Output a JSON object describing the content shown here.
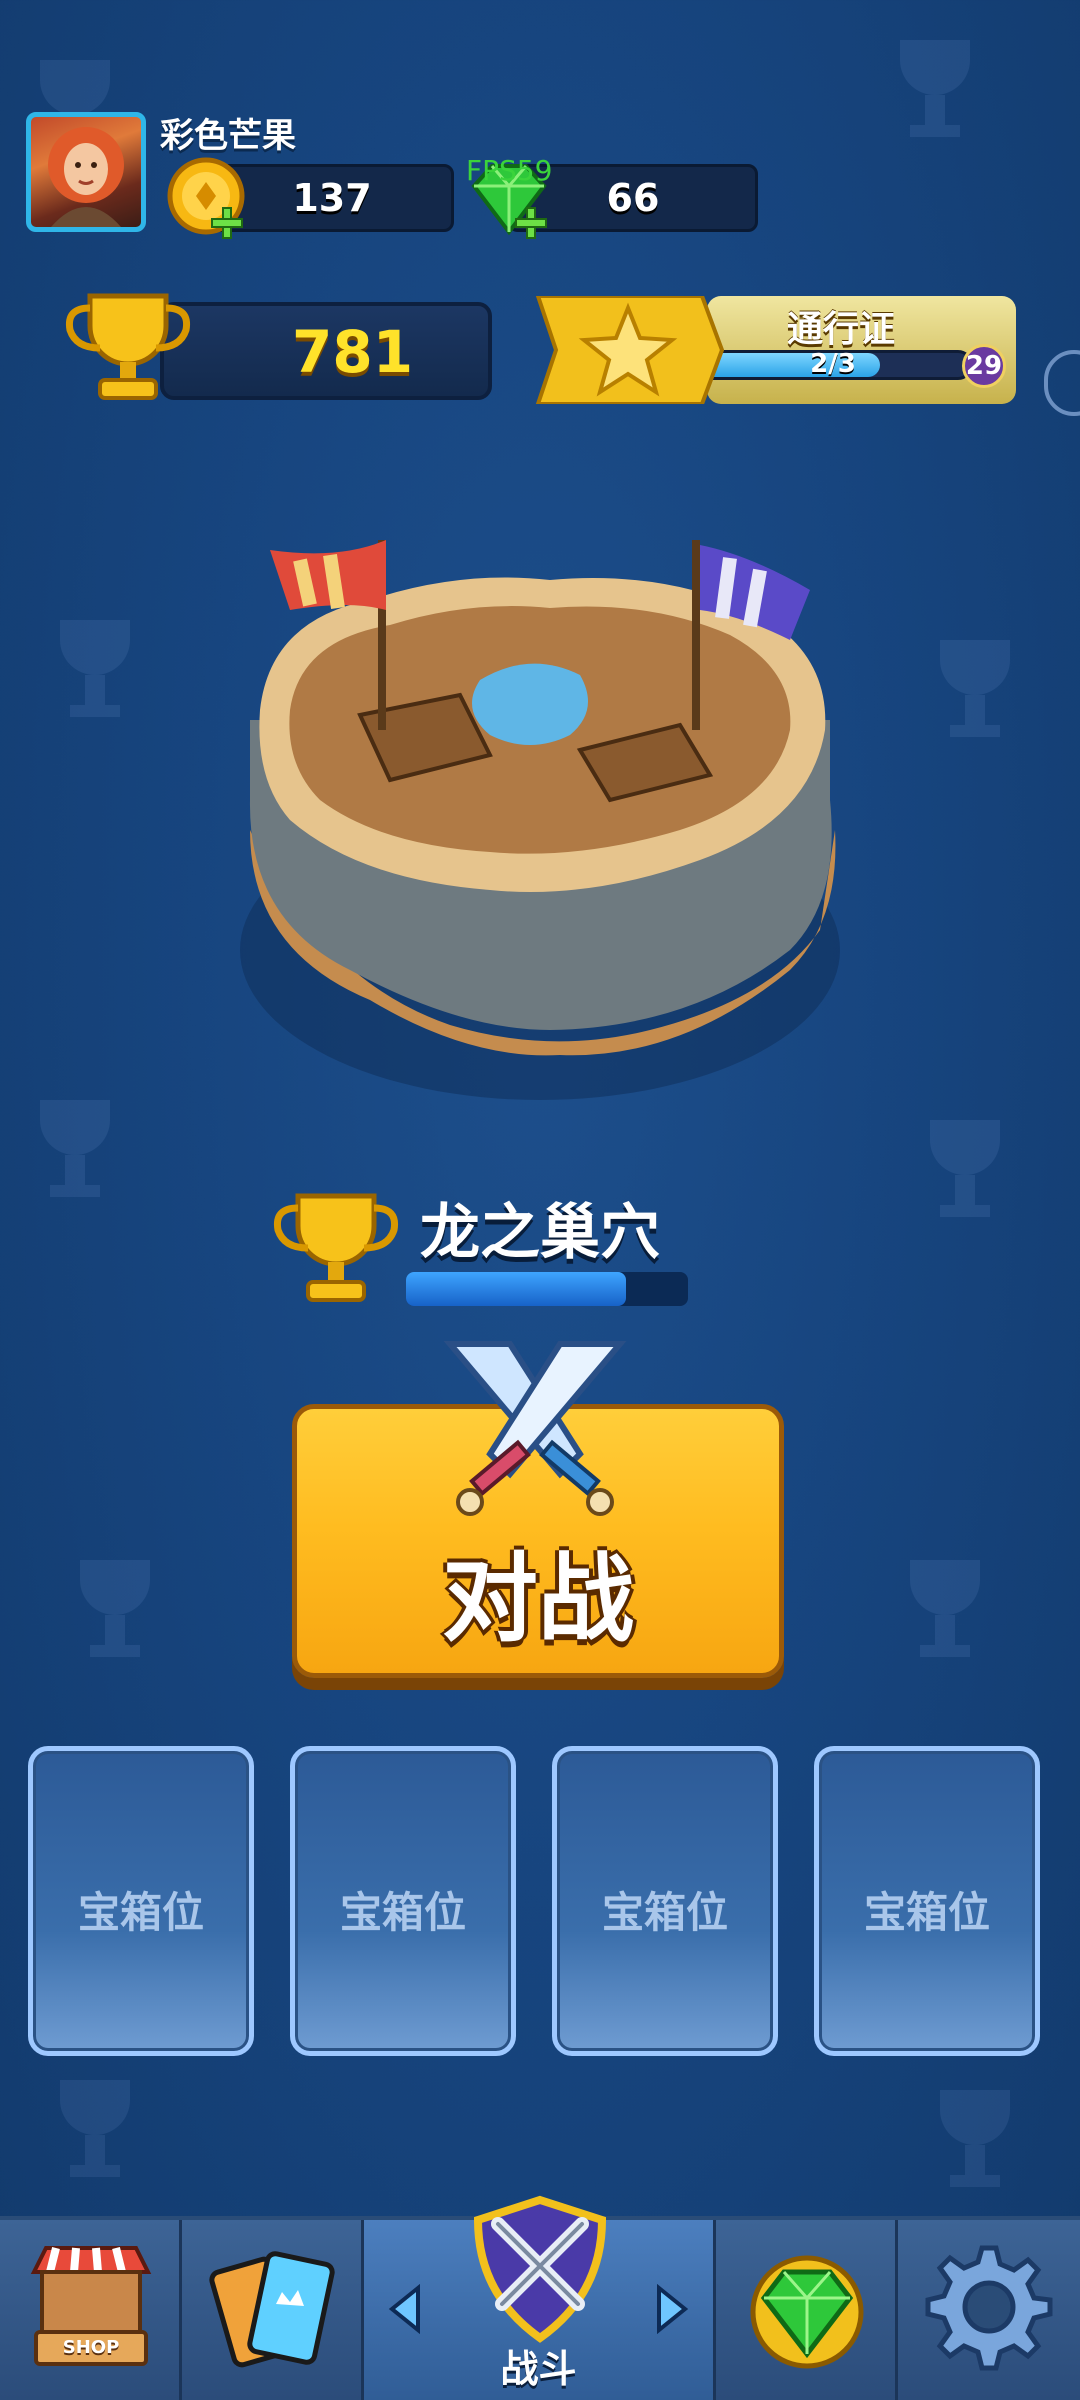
{
  "player": {
    "name": "彩色芒果",
    "coins": "137",
    "gems": "66",
    "fps": "FPS59",
    "trophies": "781"
  },
  "pass": {
    "title": "通行证",
    "progress_text": "2/3",
    "progress_fraction": 0.67,
    "level": "29"
  },
  "arena": {
    "name": "龙之巢穴",
    "progress_fraction": 0.78
  },
  "battle_button": {
    "label": "对战"
  },
  "chest_slots": [
    {
      "label": "宝箱位"
    },
    {
      "label": "宝箱位"
    },
    {
      "label": "宝箱位"
    },
    {
      "label": "宝箱位"
    }
  ],
  "bottom_nav": {
    "shop_sign": "SHOP",
    "active_label": "战斗",
    "items": [
      "shop-icon",
      "cards-icon",
      "battle-icon",
      "gem-icon",
      "settings-icon"
    ]
  },
  "colors": {
    "background": "#17457f",
    "trophy_text": "#ffe22a",
    "battle_button": "#ffbc20",
    "slot_border": "#9ec8ff"
  }
}
